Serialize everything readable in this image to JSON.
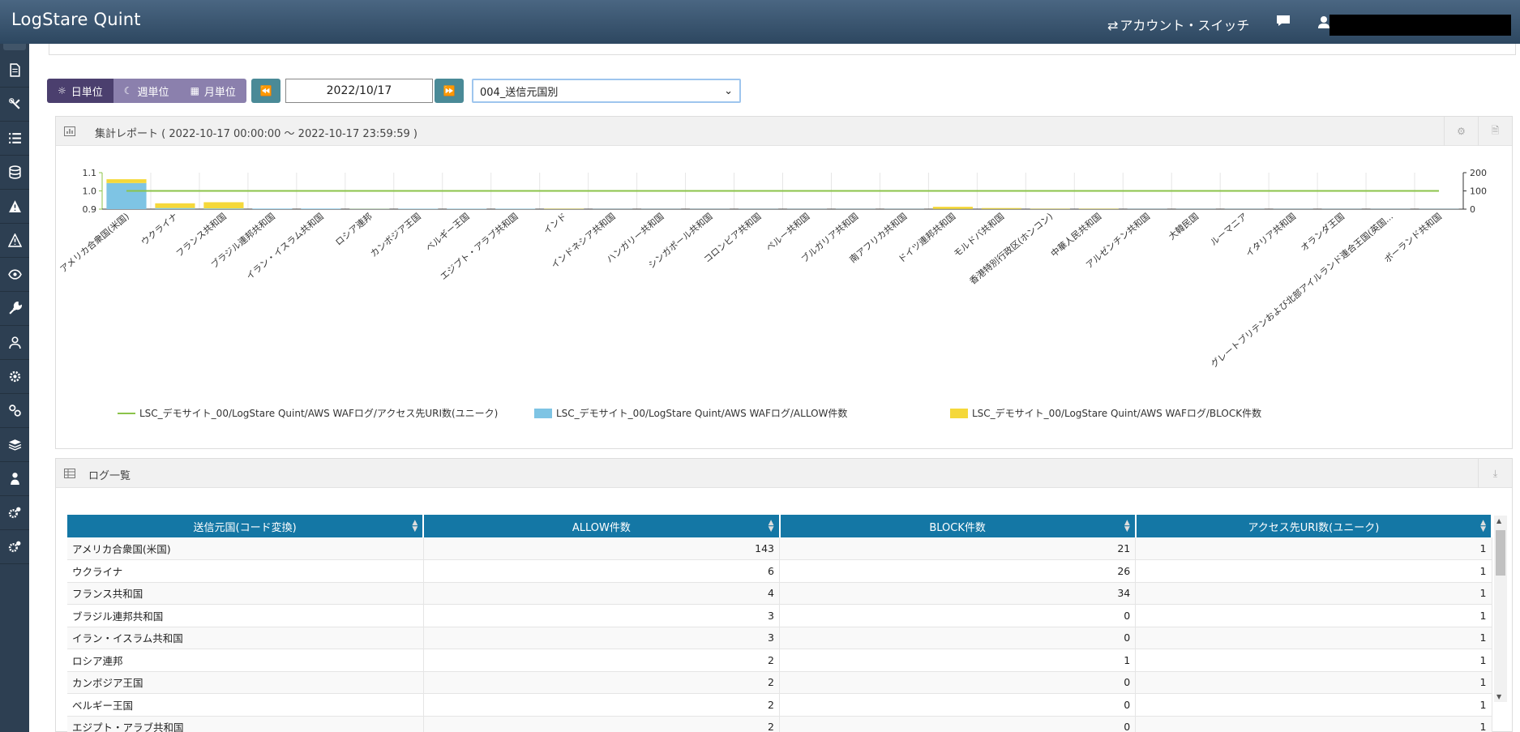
{
  "app": {
    "title": "LogStare Quint"
  },
  "header": {
    "account_switch": "アカウント・スイッチ"
  },
  "sidebar": {
    "icons": [
      "report-icon",
      "wrench-cross-icon",
      "list-icon",
      "database-icon",
      "alert-icon",
      "warning-icon",
      "eye-icon",
      "wrench-icon",
      "user-group-icon",
      "gear-icon",
      "gears-icon",
      "layers-icon",
      "sitemap-icon",
      "cogs-icon",
      "cog-icon"
    ]
  },
  "toolbar": {
    "periods": [
      {
        "label": "日単位",
        "icon": "sun-icon",
        "active": true
      },
      {
        "label": "週単位",
        "icon": "moon-icon",
        "active": false
      },
      {
        "label": "月単位",
        "icon": "calendar-icon",
        "active": false
      }
    ],
    "date": "2022/10/17",
    "report_select": "004_送信元国別"
  },
  "report_panel": {
    "title": "集計レポート ( 2022-10-17 00:00:00 ～ 2022-10-17 23:59:59 )"
  },
  "chart_data": {
    "type": "bar",
    "categories": [
      "アメリカ合衆国(米国)",
      "ウクライナ",
      "フランス共和国",
      "ブラジル連邦共和国",
      "イラン・イスラム共和国",
      "ロシア連邦",
      "カンボジア王国",
      "ベルギー王国",
      "エジプト・アラブ共和国",
      "インド",
      "インドネシア共和国",
      "ハンガリー共和国",
      "シンガポール共和国",
      "コロンビア共和国",
      "ペルー共和国",
      "ブルガリア共和国",
      "南アフリカ共和国",
      "ドイツ連邦共和国",
      "モルドバ共和国",
      "香港特別行政区(ホンコン)",
      "中華人民共和国",
      "アルゼンチン共和国",
      "大韓民国",
      "ルーマニア",
      "イタリア共和国",
      "オランダ王国",
      "グレートブリテンおよび北部アイルランド連合王国(英国...",
      "ポーランド共和国"
    ],
    "series": [
      {
        "name": "LSC_デモサイト_00/LogStare Quint/AWS WAFログ/アクセス先URI数(ユニーク)",
        "type": "line",
        "axis": "left",
        "color": "#8bc34a",
        "values": [
          1,
          1,
          1,
          1,
          1,
          1,
          1,
          1,
          1,
          1,
          1,
          1,
          1,
          1,
          1,
          1,
          1,
          1,
          1,
          1,
          1,
          1,
          1,
          1,
          1,
          1,
          1,
          1
        ]
      },
      {
        "name": "LSC_デモサイト_00/LogStare Quint/AWS WAFログ/ALLOW件数",
        "type": "bar",
        "axis": "right",
        "color": "#7ec4e4",
        "values": [
          143,
          6,
          4,
          3,
          3,
          2,
          2,
          2,
          2,
          1,
          1,
          1,
          1,
          1,
          1,
          1,
          1,
          1,
          1,
          1,
          1,
          1,
          1,
          1,
          1,
          1,
          1,
          1
        ]
      },
      {
        "name": "LSC_デモサイト_00/LogStare Quint/AWS WAFログ/BLOCK件数",
        "type": "bar",
        "axis": "right",
        "color": "#f5d83a",
        "values": [
          21,
          26,
          34,
          0,
          0,
          1,
          0,
          0,
          0,
          2,
          0,
          0,
          0,
          0,
          0,
          0,
          0,
          12,
          5,
          2,
          2,
          0,
          0,
          0,
          0,
          0,
          0,
          0
        ]
      }
    ],
    "y_left": {
      "ticks": [
        "0.9",
        "1.0",
        "1.1"
      ],
      "range": [
        0.9,
        1.1
      ]
    },
    "y_right": {
      "ticks": [
        "0",
        "100",
        "200"
      ],
      "range": [
        0,
        200
      ]
    },
    "stacked": true,
    "legend_position": "bottom",
    "grid": true
  },
  "log_panel": {
    "title": "ログ一覧"
  },
  "log_table": {
    "columns": [
      "送信元国(コード変換)",
      "ALLOW件数",
      "BLOCK件数",
      "アクセス先URI数(ユニーク)"
    ],
    "rows": [
      [
        "アメリカ合衆国(米国)",
        "143",
        "21",
        "1"
      ],
      [
        "ウクライナ",
        "6",
        "26",
        "1"
      ],
      [
        "フランス共和国",
        "4",
        "34",
        "1"
      ],
      [
        "ブラジル連邦共和国",
        "3",
        "0",
        "1"
      ],
      [
        "イラン・イスラム共和国",
        "3",
        "0",
        "1"
      ],
      [
        "ロシア連邦",
        "2",
        "1",
        "1"
      ],
      [
        "カンボジア王国",
        "2",
        "0",
        "1"
      ],
      [
        "ベルギー王国",
        "2",
        "0",
        "1"
      ],
      [
        "エジプト・アラブ共和国",
        "2",
        "0",
        "1"
      ]
    ]
  }
}
